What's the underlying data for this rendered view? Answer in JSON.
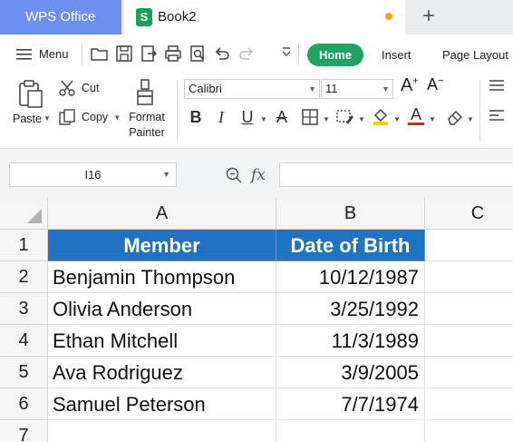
{
  "titlebar": {
    "app_tab": "WPS Office",
    "doc_tab": "Book2",
    "doc_icon": "S",
    "unsaved_dot_color": "#f2a516",
    "add_tab_icon": "+"
  },
  "quickbar": {
    "menu_label": "Menu",
    "tabs": [
      "Home",
      "Insert",
      "Page Layout"
    ]
  },
  "ribbon": {
    "paste_label": "Paste",
    "cut_label": "Cut",
    "copy_label": "Copy",
    "format_painter_label": "Format\nPainter",
    "font_name": "Calibri",
    "font_size": "11",
    "font_grow": "A",
    "font_shrink": "A",
    "bold": "B",
    "italic": "I",
    "underline": "U",
    "strike": "A",
    "font_color": "A",
    "font_color_bar": "#e02020",
    "fill_color_bar": "#f5d000"
  },
  "formula_bar": {
    "name_box": "I16",
    "fx": "fx",
    "formula": ""
  },
  "sheet": {
    "columns": [
      "A",
      "B",
      "C"
    ],
    "rows": [
      "1",
      "2",
      "3",
      "4",
      "5",
      "6",
      "7"
    ],
    "header": [
      "Member",
      "Date of Birth"
    ],
    "header_fill": "#1f73c2",
    "data": [
      [
        "Benjamin Thompson",
        "10/12/1987"
      ],
      [
        "Olivia Anderson",
        "3/25/1992"
      ],
      [
        "Ethan Mitchell",
        "11/3/1989"
      ],
      [
        "Ava Rodriguez",
        "3/9/2005"
      ],
      [
        "Samuel Peterson",
        "7/7/1974"
      ]
    ]
  }
}
